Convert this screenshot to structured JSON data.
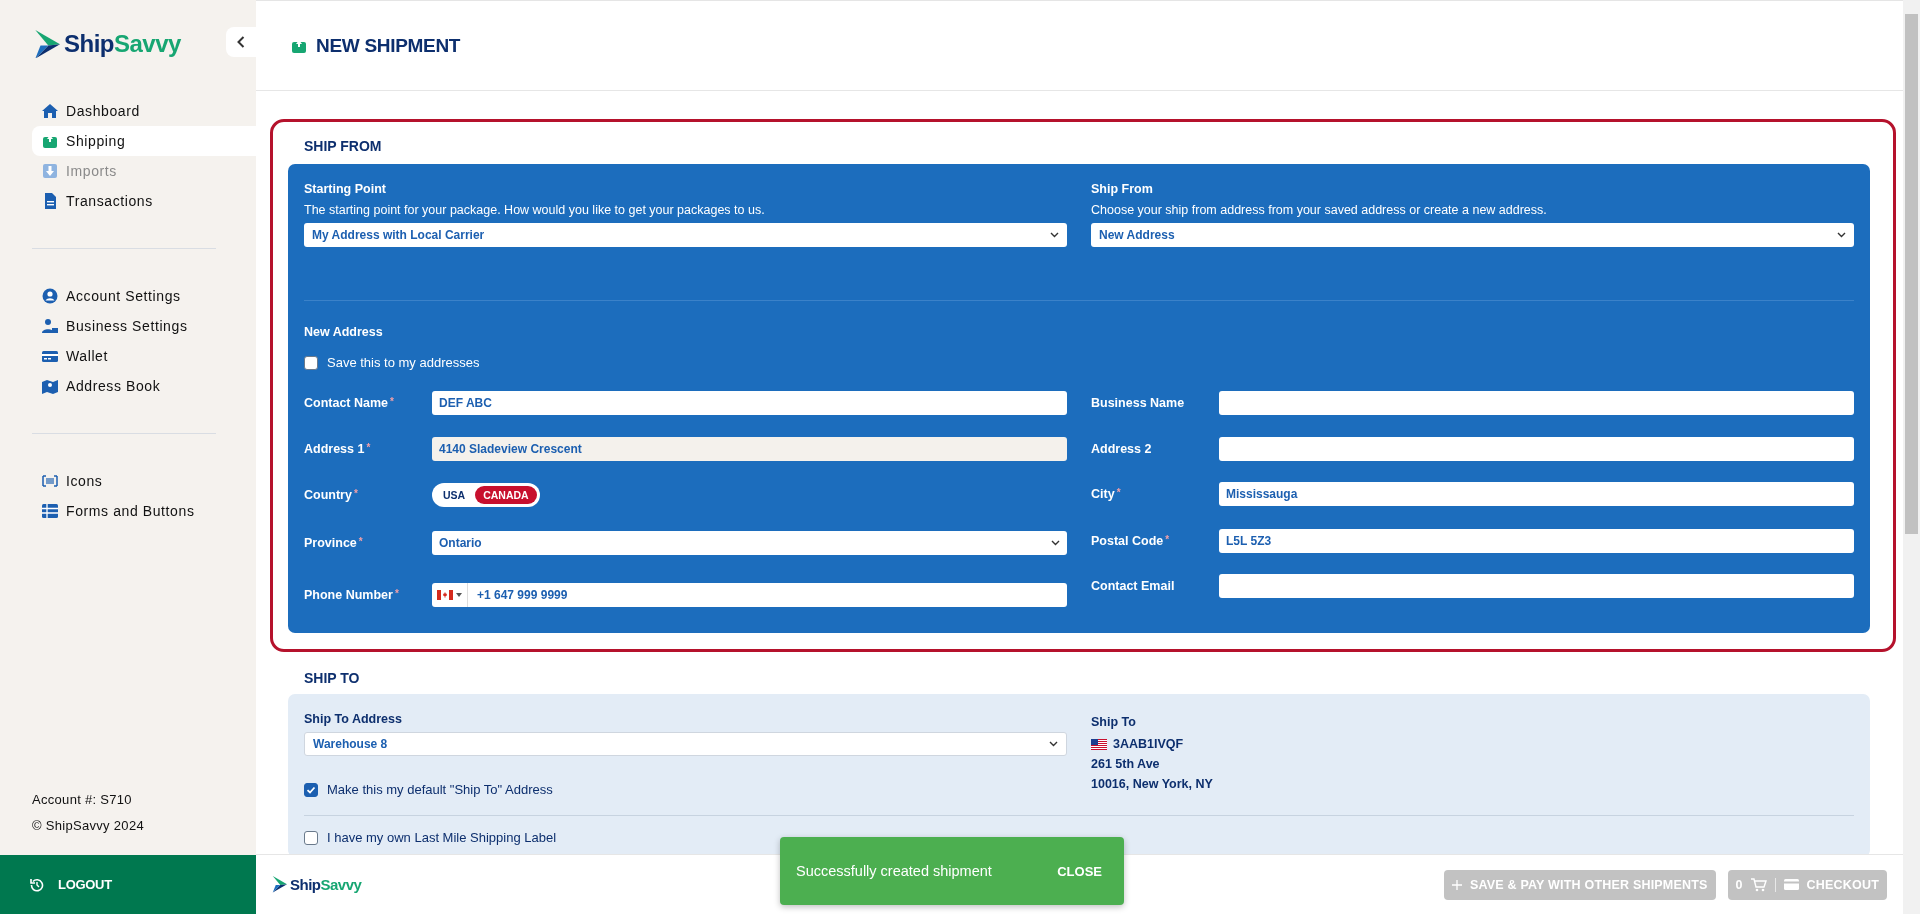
{
  "sidebar": {
    "logo_primary": "Ship",
    "logo_accent": "Savvy",
    "nav_groups": [
      [
        {
          "label": "Dashboard",
          "selected": false,
          "disabled": false
        },
        {
          "label": "Shipping",
          "selected": true,
          "disabled": false
        },
        {
          "label": "Imports",
          "selected": false,
          "disabled": true
        },
        {
          "label": "Transactions",
          "selected": false,
          "disabled": false
        }
      ],
      [
        {
          "label": "Account Settings",
          "selected": false,
          "disabled": false
        },
        {
          "label": "Business Settings",
          "selected": false,
          "disabled": false
        },
        {
          "label": "Wallet",
          "selected": false,
          "disabled": false
        },
        {
          "label": "Address Book",
          "selected": false,
          "disabled": false
        }
      ],
      [
        {
          "label": "Icons",
          "selected": false,
          "disabled": false
        },
        {
          "label": "Forms and Buttons",
          "selected": false,
          "disabled": false
        }
      ]
    ],
    "account": "Account #: S710",
    "copyright": "© ShipSavvy 2024",
    "logout": "LOGOUT"
  },
  "page_title": "NEW SHIPMENT",
  "ship_from": {
    "title": "SHIP FROM",
    "selects": [
      {
        "label": "Starting Point",
        "description": "The starting point for your package. How would you like to get your packages to us.",
        "value": "My Address with Local Carrier"
      },
      {
        "label": "Ship From",
        "description": "Choose your ship from address from your saved address or create a new address.",
        "value": "New Address"
      }
    ],
    "new_address_title": "New Address",
    "save_label": "Save this to my addresses",
    "save_checked": false,
    "left_fields": [
      {
        "kind": "text",
        "label": "Contact Name",
        "required_mark": "*",
        "value": "DEF ABC",
        "autofilled": false
      },
      {
        "kind": "text",
        "label": "Address 1",
        "required_mark": "*",
        "value": "4140 Sladeview Crescent",
        "autofilled": true
      },
      {
        "kind": "toggle",
        "label": "Country",
        "required_mark": "*",
        "options": [
          {
            "label": "USA",
            "selected": false
          },
          {
            "label": "CANADA",
            "selected": true
          }
        ]
      },
      {
        "kind": "select",
        "label": "Province",
        "required_mark": "*",
        "value": "Ontario"
      },
      {
        "kind": "phone",
        "label": "Phone Number",
        "required_mark": "*",
        "value": "+1 647 999 9999"
      }
    ],
    "right_fields": [
      {
        "kind": "text",
        "label": "Business Name",
        "autofilled": false
      },
      {
        "kind": "text",
        "label": "Address 2",
        "autofilled": false
      },
      {
        "kind": "text",
        "label": "City",
        "required_mark": "*",
        "value": "Mississauga",
        "autofilled": false
      },
      {
        "kind": "text",
        "label": "Postal Code",
        "required_mark": "*",
        "value": "L5L 5Z3",
        "autofilled": false
      },
      {
        "kind": "text",
        "label": "Contact Email",
        "autofilled": false
      }
    ]
  },
  "ship_to": {
    "title": "SHIP TO",
    "address_label": "Ship To Address",
    "address_value": "Warehouse 8",
    "default_label": "Make this my default \"Ship To\" Address",
    "default_checked": true,
    "last_mile_label": "I have my own Last Mile Shipping Label",
    "last_mile_checked": false,
    "dest_title": "Ship To",
    "dest_code": "3AAB1IVQF",
    "dest_lines": [
      "261 5th Ave",
      "10016, New York, NY"
    ]
  },
  "footer": {
    "logo_primary": "Ship",
    "logo_accent": "Savvy",
    "save_pay": "SAVE & PAY WITH OTHER SHIPMENTS",
    "cart_count": "0",
    "checkout": "CHECKOUT",
    "disabled": true
  },
  "toast": {
    "message": "Successfully created shipment",
    "action": "CLOSE"
  }
}
